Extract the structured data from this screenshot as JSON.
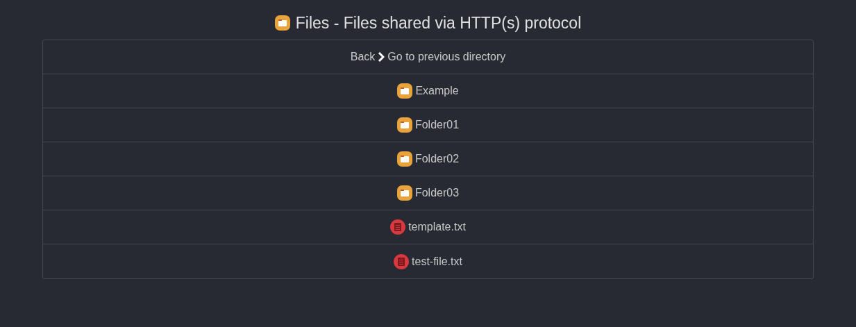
{
  "title": "Files - Files shared via HTTP(s) protocol",
  "back": {
    "label": "Back",
    "text": "Go to previous directory"
  },
  "entries": [
    {
      "kind": "folder",
      "name": "Example"
    },
    {
      "kind": "folder",
      "name": "Folder01"
    },
    {
      "kind": "folder",
      "name": "Folder02"
    },
    {
      "kind": "folder",
      "name": "Folder03"
    },
    {
      "kind": "file",
      "name": "template.txt"
    },
    {
      "kind": "file",
      "name": "test-file.txt"
    }
  ]
}
